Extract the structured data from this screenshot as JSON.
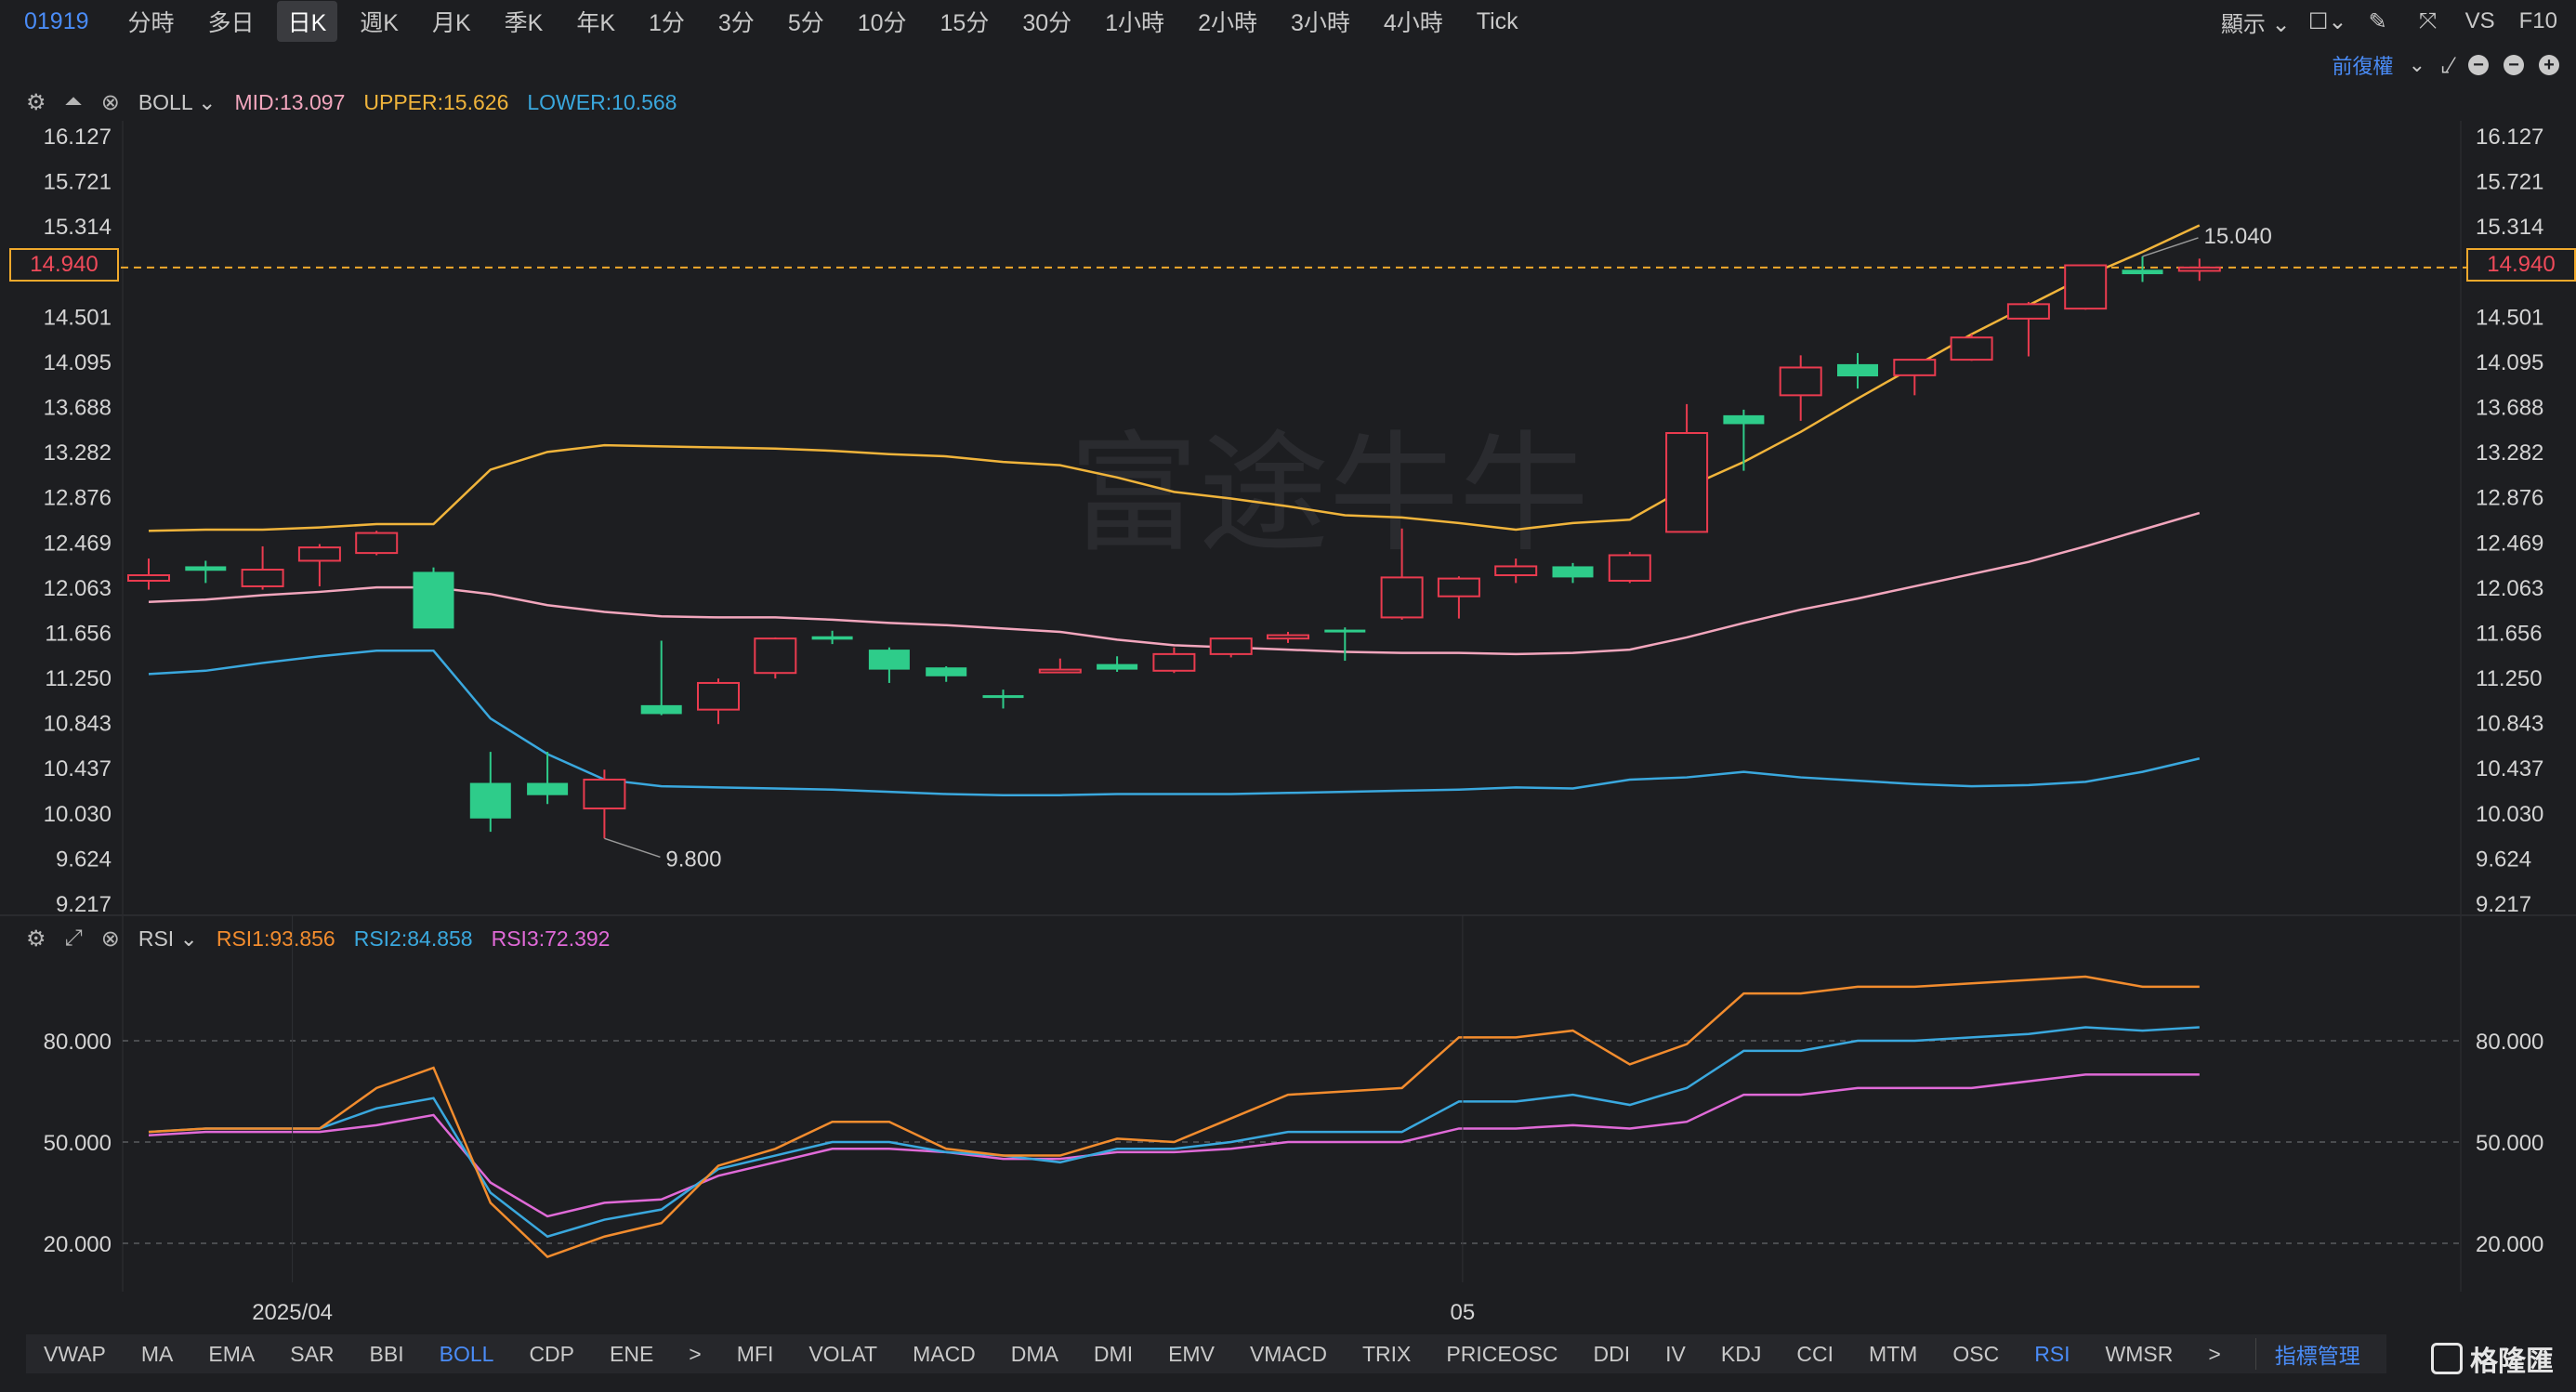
{
  "toolbar": {
    "ticker": "01919",
    "periods": [
      "分時",
      "多日",
      "日K",
      "週K",
      "月K",
      "季K",
      "年K",
      "1分",
      "3分",
      "5分",
      "10分",
      "15分",
      "30分",
      "1小時",
      "2小時",
      "3小時",
      "4小時",
      "Tick"
    ],
    "active_period": "日K",
    "display_label": "顯示",
    "vs_label": "VS",
    "f10_label": "F10",
    "adjust_label": "前復權"
  },
  "main_indicator": {
    "name": "BOLL",
    "mid": "MID:13.097",
    "upper": "UPPER:15.626",
    "lower": "LOWER:10.568",
    "colors": {
      "mid": "#f2a6bd",
      "upper": "#f0b43b",
      "lower": "#3aa8de"
    }
  },
  "sub_indicator": {
    "name": "RSI",
    "rsi1": "RSI1:93.856",
    "rsi2": "RSI2:84.858",
    "rsi3": "RSI3:72.392",
    "colors": {
      "rsi1": "#f28c2e",
      "rsi2": "#3aa8de",
      "rsi3": "#e06ad8"
    }
  },
  "price_axis": {
    "ticks": [
      "16.127",
      "15.721",
      "15.314",
      "14.940",
      "14.501",
      "14.095",
      "13.688",
      "13.282",
      "12.876",
      "12.469",
      "12.063",
      "11.656",
      "11.250",
      "10.843",
      "10.437",
      "10.030",
      "9.624",
      "9.217"
    ],
    "last_price": "14.940",
    "high_label": "15.040",
    "low_label": "9.800"
  },
  "rsi_axis": {
    "ticks": [
      "80.000",
      "50.000",
      "20.000"
    ]
  },
  "time_axis": {
    "labels": [
      "2025/04",
      "05"
    ]
  },
  "watermark": "富途牛牛",
  "indicator_bar": {
    "items": [
      "VWAP",
      "MA",
      "EMA",
      "SAR",
      "BBI",
      "BOLL",
      "CDP",
      "ENE",
      ">",
      "MFI",
      "VOLAT",
      "MACD",
      "DMA",
      "DMI",
      "EMV",
      "VMACD",
      "TRIX",
      "PRICEOSC",
      "DDI",
      "IV",
      "KDJ",
      "CCI",
      "MTM",
      "OSC",
      "RSI",
      "WMSR",
      ">"
    ],
    "active": [
      "BOLL",
      "RSI"
    ],
    "manage_label": "指標管理"
  },
  "logo_text": "格隆匯",
  "chart_data": {
    "type": "candlestick",
    "colors": {
      "up": "#ea3b4f",
      "down": "#2ecc8a"
    },
    "ylim": [
      9.217,
      16.127
    ],
    "candles": [
      {
        "o": 12.12,
        "h": 12.32,
        "l": 12.04,
        "c": 12.17
      },
      {
        "o": 12.25,
        "h": 12.3,
        "l": 12.1,
        "c": 12.21
      },
      {
        "o": 12.07,
        "h": 12.43,
        "l": 12.04,
        "c": 12.22
      },
      {
        "o": 12.3,
        "h": 12.45,
        "l": 12.07,
        "c": 12.42
      },
      {
        "o": 12.37,
        "h": 12.57,
        "l": 12.35,
        "c": 12.55
      },
      {
        "o": 12.2,
        "h": 12.24,
        "l": 11.7,
        "c": 11.69
      },
      {
        "o": 10.3,
        "h": 10.58,
        "l": 9.86,
        "c": 9.98
      },
      {
        "o": 10.3,
        "h": 10.58,
        "l": 10.11,
        "c": 10.19
      },
      {
        "o": 10.07,
        "h": 10.42,
        "l": 9.8,
        "c": 10.33
      },
      {
        "o": 11.0,
        "h": 11.58,
        "l": 10.91,
        "c": 10.92
      },
      {
        "o": 10.96,
        "h": 11.24,
        "l": 10.83,
        "c": 11.2
      },
      {
        "o": 11.29,
        "h": 11.61,
        "l": 11.24,
        "c": 11.6
      },
      {
        "o": 11.62,
        "h": 11.67,
        "l": 11.55,
        "c": 11.59
      },
      {
        "o": 11.5,
        "h": 11.52,
        "l": 11.2,
        "c": 11.32
      },
      {
        "o": 11.34,
        "h": 11.35,
        "l": 11.21,
        "c": 11.26
      },
      {
        "o": 11.09,
        "h": 11.14,
        "l": 10.97,
        "c": 11.08
      },
      {
        "o": 11.3,
        "h": 11.42,
        "l": 11.29,
        "c": 11.32
      },
      {
        "o": 11.37,
        "h": 11.44,
        "l": 11.3,
        "c": 11.32
      },
      {
        "o": 11.31,
        "h": 11.52,
        "l": 11.29,
        "c": 11.46
      },
      {
        "o": 11.46,
        "h": 11.6,
        "l": 11.43,
        "c": 11.6
      },
      {
        "o": 11.6,
        "h": 11.66,
        "l": 11.56,
        "c": 11.63
      },
      {
        "o": 11.68,
        "h": 11.7,
        "l": 11.4,
        "c": 11.66
      },
      {
        "o": 11.79,
        "h": 12.59,
        "l": 11.77,
        "c": 12.15
      },
      {
        "o": 11.98,
        "h": 12.16,
        "l": 11.78,
        "c": 12.14
      },
      {
        "o": 12.17,
        "h": 12.32,
        "l": 12.1,
        "c": 12.25
      },
      {
        "o": 12.25,
        "h": 12.28,
        "l": 12.1,
        "c": 12.15
      },
      {
        "o": 12.12,
        "h": 12.38,
        "l": 12.1,
        "c": 12.35
      },
      {
        "o": 12.56,
        "h": 13.71,
        "l": 12.56,
        "c": 13.45
      },
      {
        "o": 13.61,
        "h": 13.66,
        "l": 13.11,
        "c": 13.53
      },
      {
        "o": 13.79,
        "h": 14.15,
        "l": 13.56,
        "c": 14.04
      },
      {
        "o": 14.07,
        "h": 14.17,
        "l": 13.85,
        "c": 13.96
      },
      {
        "o": 13.97,
        "h": 14.11,
        "l": 13.79,
        "c": 14.11
      },
      {
        "o": 14.11,
        "h": 14.34,
        "l": 14.1,
        "c": 14.31
      },
      {
        "o": 14.48,
        "h": 14.63,
        "l": 14.14,
        "c": 14.61
      },
      {
        "o": 14.57,
        "h": 14.96,
        "l": 14.56,
        "c": 14.96
      },
      {
        "o": 14.92,
        "h": 15.04,
        "l": 14.81,
        "c": 14.88
      },
      {
        "o": 14.91,
        "h": 15.02,
        "l": 14.82,
        "c": 14.94
      }
    ],
    "boll_upper": [
      12.57,
      12.58,
      12.58,
      12.6,
      12.63,
      12.63,
      13.12,
      13.28,
      13.34,
      13.33,
      13.32,
      13.31,
      13.29,
      13.26,
      13.24,
      13.19,
      13.16,
      13.05,
      12.92,
      12.86,
      12.79,
      12.71,
      12.69,
      12.64,
      12.58,
      12.64,
      12.67,
      12.96,
      13.19,
      13.46,
      13.76,
      14.05,
      14.34,
      14.6,
      14.86,
      15.08,
      15.32
    ],
    "boll_mid": [
      11.93,
      11.95,
      11.99,
      12.02,
      12.06,
      12.06,
      12.0,
      11.9,
      11.84,
      11.8,
      11.79,
      11.79,
      11.77,
      11.74,
      11.72,
      11.69,
      11.66,
      11.59,
      11.54,
      11.52,
      11.5,
      11.48,
      11.47,
      11.47,
      11.46,
      11.47,
      11.5,
      11.61,
      11.74,
      11.86,
      11.96,
      12.07,
      12.18,
      12.29,
      12.43,
      12.58,
      12.73
    ],
    "boll_lower": [
      11.28,
      11.31,
      11.38,
      11.44,
      11.49,
      11.49,
      10.88,
      10.56,
      10.33,
      10.27,
      10.26,
      10.25,
      10.24,
      10.22,
      10.2,
      10.19,
      10.19,
      10.2,
      10.2,
      10.2,
      10.21,
      10.22,
      10.23,
      10.24,
      10.26,
      10.25,
      10.33,
      10.35,
      10.4,
      10.35,
      10.32,
      10.29,
      10.27,
      10.28,
      10.31,
      10.4,
      10.52
    ],
    "rsi1": [
      53,
      54,
      54,
      54,
      66,
      72,
      32,
      16,
      22,
      26,
      43,
      48,
      56,
      56,
      48,
      46,
      46,
      51,
      50,
      57,
      64,
      65,
      66,
      81,
      81,
      83,
      73,
      79,
      94,
      94,
      96,
      96,
      97,
      98,
      99,
      96,
      96
    ],
    "rsi2": [
      53,
      54,
      54,
      54,
      60,
      63,
      35,
      22,
      27,
      30,
      42,
      46,
      50,
      50,
      47,
      46,
      44,
      48,
      48,
      50,
      53,
      53,
      53,
      62,
      62,
      64,
      61,
      66,
      77,
      77,
      80,
      80,
      81,
      82,
      84,
      83,
      84
    ],
    "rsi3": [
      52,
      53,
      53,
      53,
      55,
      58,
      38,
      28,
      32,
      33,
      40,
      44,
      48,
      48,
      47,
      45,
      45,
      47,
      47,
      48,
      50,
      50,
      50,
      54,
      54,
      55,
      54,
      56,
      64,
      64,
      66,
      66,
      66,
      68,
      70,
      70,
      70
    ],
    "rsi_ylim": [
      0,
      100
    ]
  }
}
